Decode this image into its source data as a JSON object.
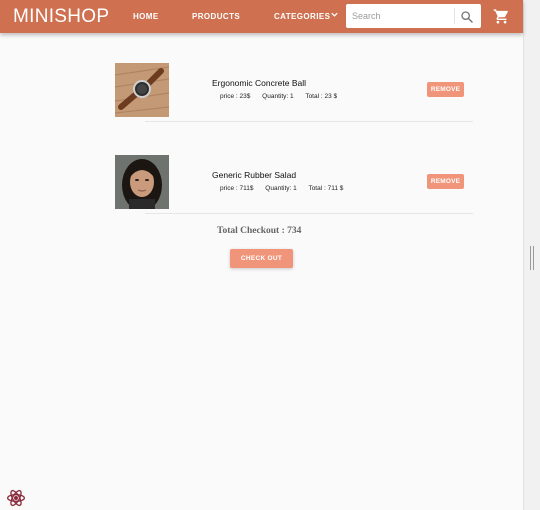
{
  "header": {
    "brand": "MINISHOP",
    "nav": {
      "home": "HOME",
      "products": "PRODUCTS",
      "categories": "CATEGORIES"
    },
    "search_placeholder": "Search",
    "color": "#cf7151"
  },
  "cart": {
    "items": [
      {
        "name": "Ergonomic Concrete Ball",
        "price": "price : 23$",
        "quantity": "Quantity: 1",
        "total": "Total : 23 $",
        "remove_label": "REMOVE",
        "image": "wristwatch photo"
      },
      {
        "name": "Generic Rubber Salad",
        "price": "price : 711$",
        "quantity": "Quantity: 1",
        "total": "Total : 711 $",
        "remove_label": "REMOVE",
        "image": "portrait photo"
      }
    ],
    "total_label": "Total Checkout : 734",
    "checkout_label": "CHECK OUT",
    "button_color": "#f0957a"
  },
  "icons": [
    "chevron-down-icon",
    "search-icon",
    "shopping-cart-icon",
    "react-icon"
  ]
}
